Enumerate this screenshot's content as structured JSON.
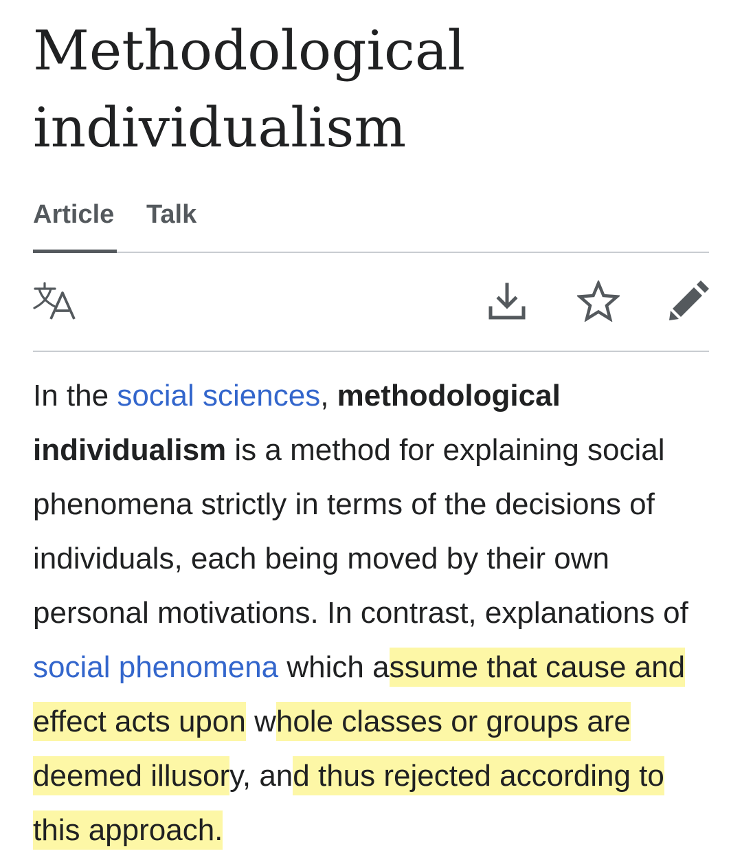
{
  "page": {
    "title_line1": "Methodological",
    "title_line2": "individualism"
  },
  "tabs": [
    {
      "label": "Article",
      "active": true
    },
    {
      "label": "Talk",
      "active": false
    }
  ],
  "toolbar": {
    "language_icon": "translate-icon",
    "download_icon": "download-icon",
    "watch_icon": "star-icon",
    "edit_icon": "pencil-icon"
  },
  "article": {
    "s1": "In the ",
    "link1": "social sciences",
    "s2": ", ",
    "bold": "methodological individualism",
    "s3": " is a method for explaining social phenomena strictly in terms of the decisions of individuals, each being moved by their own personal motivations. In contrast, explanations of ",
    "link2": "social phenomena",
    "s4": " which a",
    "h1": "ssume that cause and effect acts upon",
    "s5": " w",
    "h2": "hole classes or groups are deemed illusor",
    "s6": "y, an",
    "h3": "d thus rejected according to this approach."
  },
  "colors": {
    "link": "#3366cc",
    "text": "#202122",
    "highlight": "#fdf7a6",
    "icon": "#54595d"
  }
}
